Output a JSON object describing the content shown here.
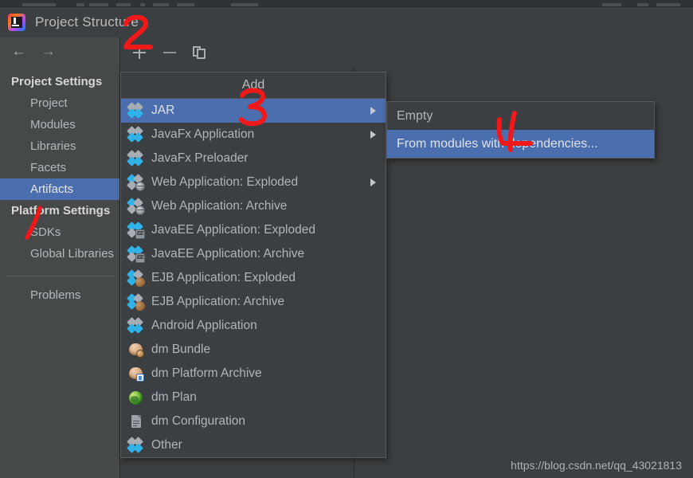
{
  "dialog": {
    "title": "Project Structure",
    "app_icon": "intellij-idea-icon"
  },
  "nav_toolbar": {
    "back": "←",
    "forward": "→"
  },
  "sidebar": {
    "groups": [
      {
        "label": "Project Settings",
        "items": [
          {
            "label": "Project",
            "selected": false
          },
          {
            "label": "Modules",
            "selected": false
          },
          {
            "label": "Libraries",
            "selected": false
          },
          {
            "label": "Facets",
            "selected": false
          },
          {
            "label": "Artifacts",
            "selected": true
          }
        ]
      },
      {
        "label": "Platform Settings",
        "items": [
          {
            "label": "SDKs",
            "selected": false
          },
          {
            "label": "Global Libraries",
            "selected": false
          }
        ]
      }
    ],
    "footer": {
      "label": "Problems"
    }
  },
  "content_toolbar": {
    "add": "add-plus-icon",
    "remove": "remove-minus-icon",
    "copy": "copy-icon"
  },
  "add_menu": {
    "header": "Add",
    "items": [
      {
        "label": "JAR",
        "icon": "diamond-icon",
        "selected": true,
        "submenu": true
      },
      {
        "label": "JavaFx Application",
        "icon": "diamond-icon",
        "selected": false,
        "submenu": true
      },
      {
        "label": "JavaFx Preloader",
        "icon": "diamond-icon",
        "selected": false,
        "submenu": false
      },
      {
        "label": "Web Application: Exploded",
        "icon": "web-diamond-icon",
        "selected": false,
        "submenu": true
      },
      {
        "label": "Web Application: Archive",
        "icon": "web-diamond-icon",
        "selected": false,
        "submenu": false
      },
      {
        "label": "JavaEE Application: Exploded",
        "icon": "javaee-diamond-icon",
        "selected": false,
        "submenu": false
      },
      {
        "label": "JavaEE Application: Archive",
        "icon": "javaee-diamond-icon",
        "selected": false,
        "submenu": false
      },
      {
        "label": "EJB Application: Exploded",
        "icon": "ejb-diamond-icon",
        "selected": false,
        "submenu": false
      },
      {
        "label": "EJB Application: Archive",
        "icon": "ejb-diamond-icon",
        "selected": false,
        "submenu": false
      },
      {
        "label": "Android Application",
        "icon": "diamond-icon",
        "selected": false,
        "submenu": false
      },
      {
        "label": "dm Bundle",
        "icon": "dm-bundle-icon",
        "selected": false,
        "submenu": false
      },
      {
        "label": "dm Platform Archive",
        "icon": "dm-platform-icon",
        "selected": false,
        "submenu": false
      },
      {
        "label": "dm Plan",
        "icon": "dm-plan-globe-icon",
        "selected": false,
        "submenu": false
      },
      {
        "label": "dm Configuration",
        "icon": "document-icon",
        "selected": false,
        "submenu": false
      },
      {
        "label": "Other",
        "icon": "diamond-icon",
        "selected": false,
        "submenu": false
      }
    ]
  },
  "jar_submenu": {
    "items": [
      {
        "label": "Empty",
        "selected": false
      },
      {
        "label": "From modules with dependencies...",
        "selected": true
      }
    ]
  },
  "annotations": [
    {
      "name": "annotation-1",
      "text": "1"
    },
    {
      "name": "annotation-2",
      "text": "2"
    },
    {
      "name": "annotation-3",
      "text": "3"
    },
    {
      "name": "annotation-4",
      "text": "4"
    }
  ],
  "watermark": {
    "text": "https://blog.csdn.net/qq_43021813"
  },
  "colors": {
    "selection_blue": "#4b6eaf",
    "dialog_bg": "#3c3f41",
    "nav_bg": "#45494a",
    "annotation_red": "#f01818",
    "icon_cyan": "#2fb3e8",
    "icon_gray": "#a7adb3"
  }
}
